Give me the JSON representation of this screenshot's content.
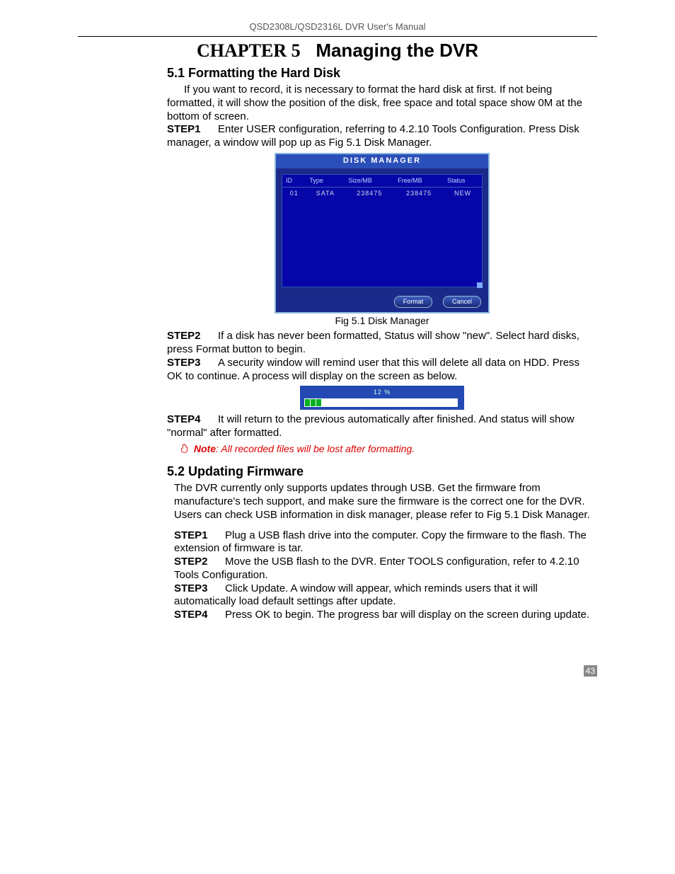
{
  "doc_header": "QSD2308L/QSD2316L DVR User's Manual",
  "chapter_title_chap": "CHAPTER 5",
  "chapter_title_rest": "Managing the DVR",
  "section_51_title": "5.1  Formatting the Hard Disk",
  "section_51_intro": "If you want to record, it is necessary to format the hard disk at first. If not being formatted, it will show the position of the disk, free space and total space show 0M at the bottom of screen.",
  "s51_step1_label": "STEP1",
  "s51_step1_text": "Enter USER configuration, referring to 4.2.10 Tools Configuration. Press Disk manager, a window will pop up as Fig 5.1 Disk Manager.",
  "disk_manager": {
    "title": "DISK MANAGER",
    "headers": {
      "id": "ID",
      "type": "Type",
      "size": "Size/MB",
      "free": "Free/MB",
      "status": "Status"
    },
    "row": {
      "id": "01",
      "type": "SATA",
      "size": "238475",
      "free": "238475",
      "status": "NEW"
    },
    "btn_format": "Format",
    "btn_cancel": "Cancel"
  },
  "fig_caption": "Fig 5.1 Disk Manager",
  "s51_step2_label": "STEP2",
  "s51_step2_text": "If a disk has never been formatted, Status will show \"new\". Select hard disks, press Format button to begin.",
  "s51_step3_label": "STEP3",
  "s51_step3_text": "A security window will remind user that this will delete all data on HDD. Press OK to continue. A process will display on the screen as below.",
  "progress_label": "12  %",
  "s51_step4_label": "STEP4",
  "s51_step4_text": "It will return to the previous automatically after finished. And status will show \"normal\" after formatted.",
  "note_label": "Note",
  "note_text": ": All recorded files will be lost after formatting.",
  "section_52_title": "5.2  Updating Firmware",
  "section_52_intro": "The DVR currently only supports updates through USB. Get the firmware from manufacture's tech support, and make sure the firmware is the correct one for the DVR. Users can check USB information in disk manager, please refer to Fig 5.1 Disk Manager.",
  "s52_step1_label": "STEP1",
  "s52_step1_text": "Plug a USB flash drive into the computer. Copy the firmware to the flash. The extension of firmware is tar.",
  "s52_step2_label": "STEP2",
  "s52_step2_text": "Move the USB flash to the DVR. Enter TOOLS configuration, refer to 4.2.10 Tools Configuration.",
  "s52_step3_label": "STEP3",
  "s52_step3_text": "Click Update. A window will appear, which reminds users that it will automatically load default settings after update.",
  "s52_step4_label": "STEP4",
  "s52_step4_text": "Press OK to begin. The progress bar will display on the screen during update.",
  "page_number": "43"
}
